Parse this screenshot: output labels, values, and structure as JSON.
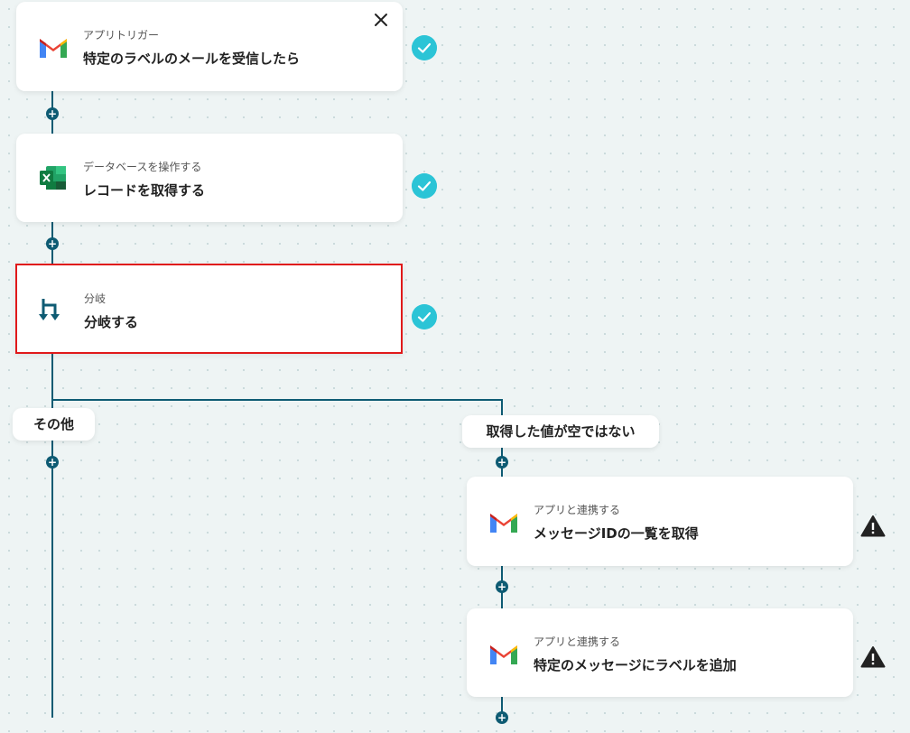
{
  "cards": [
    {
      "subtitle": "アプリトリガー",
      "title": "特定のラベルのメールを受信したら",
      "icon": "gmail-icon",
      "status": "check-icon"
    },
    {
      "subtitle": "データベースを操作する",
      "title": "レコードを取得する",
      "icon": "excel-icon",
      "status": "check-icon"
    },
    {
      "subtitle": "分岐",
      "title": "分岐する",
      "icon": "branch-icon",
      "status": "check-icon"
    },
    {
      "subtitle": "アプリと連携する",
      "title": "メッセージIDの一覧を取得",
      "icon": "gmail-icon",
      "status": "warning-icon"
    },
    {
      "subtitle": "アプリと連携する",
      "title": "特定のメッセージにラベルを追加",
      "icon": "gmail-icon",
      "status": "warning-icon"
    }
  ],
  "branches": {
    "left_label": "その他",
    "right_label": "取得した値が空ではない"
  },
  "colors": {
    "connector": "#0e5b73",
    "check": "#2bc4d6",
    "selected_border": "#e0191a"
  }
}
